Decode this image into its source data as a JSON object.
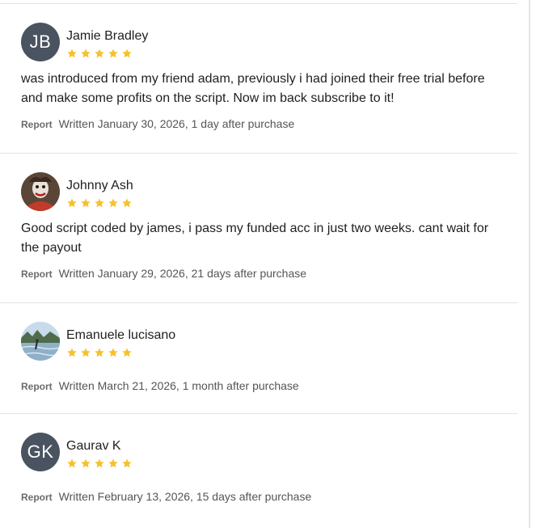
{
  "colors": {
    "star": "#f5c22b",
    "avatar_initials_bg": "#4a5360",
    "divider": "#e3e3e3"
  },
  "reviews": [
    {
      "author": "Jamie Bradley",
      "initials": "JB",
      "avatar_type": "initials",
      "rating": 5,
      "text": "was introduced from my friend adam, previously i had joined their free trial before and make some profits on the script. Now im back subscribe to it!",
      "report_label": "Report",
      "written": "Written January 30, 2026, 1 day after purchase"
    },
    {
      "author": "Johnny Ash",
      "initials": "",
      "avatar_type": "photo-clown",
      "rating": 5,
      "text": "Good script coded by james, i pass my funded acc in just two weeks. cant wait for the payout",
      "report_label": "Report",
      "written": "Written January 29, 2026, 21 days after purchase"
    },
    {
      "author": "Emanuele lucisano",
      "initials": "",
      "avatar_type": "photo-surf",
      "rating": 5,
      "text": "",
      "report_label": "Report",
      "written": "Written March 21, 2026, 1 month after purchase"
    },
    {
      "author": "Gaurav K",
      "initials": "GK",
      "avatar_type": "initials",
      "rating": 5,
      "text": "",
      "report_label": "Report",
      "written": "Written February 13, 2026, 15 days after purchase"
    }
  ]
}
